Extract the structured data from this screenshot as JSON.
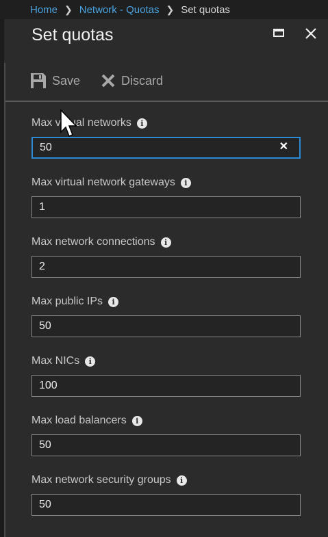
{
  "breadcrumb": {
    "items": [
      "Home",
      "Network - Quotas"
    ],
    "current": "Set quotas"
  },
  "panel": {
    "title": "Set quotas",
    "window_buttons": [
      "maximize-icon",
      "close-icon"
    ]
  },
  "toolbar": {
    "save_label": "Save",
    "discard_label": "Discard"
  },
  "fields": [
    {
      "label": "Max virtual networks",
      "value": "50",
      "focused": true
    },
    {
      "label": "Max virtual network gateways",
      "value": "1"
    },
    {
      "label": "Max network connections",
      "value": "2"
    },
    {
      "label": "Max public IPs",
      "value": "50"
    },
    {
      "label": "Max NICs",
      "value": "100"
    },
    {
      "label": "Max load balancers",
      "value": "50"
    },
    {
      "label": "Max network security groups",
      "value": "50"
    }
  ],
  "colors": {
    "background": "#2b2b2b",
    "link": "#4aa3df",
    "focus_border": "#2b8ad6"
  }
}
